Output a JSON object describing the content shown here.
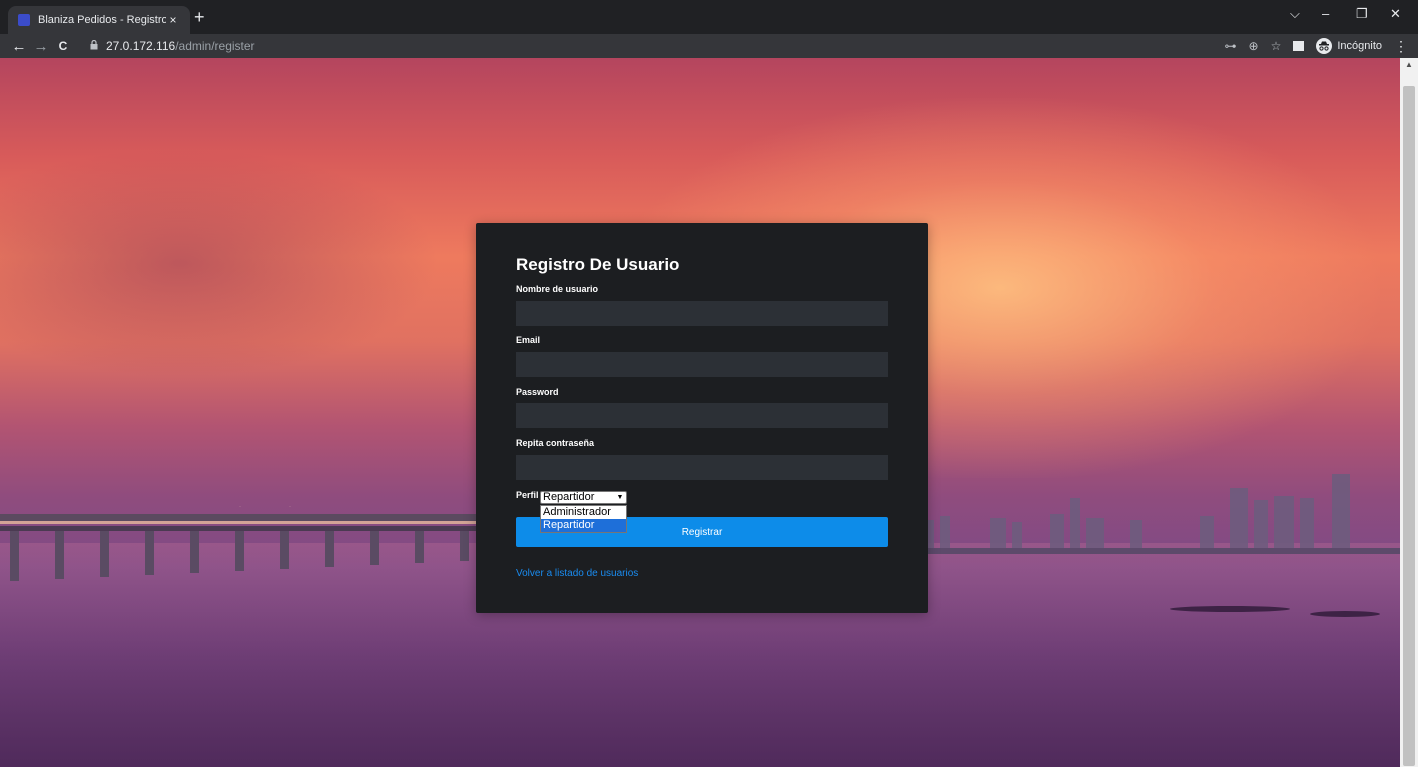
{
  "browser": {
    "tab_title": "Blaniza Pedidos - Registro",
    "tab_close": "×",
    "new_tab": "+",
    "window_controls": {
      "tab_search": "⌵",
      "minimize": "–",
      "restore": "❐",
      "close": "✕"
    },
    "nav": {
      "back": "←",
      "forward": "→",
      "reload": "C"
    },
    "url_host": "27.0.172.116",
    "url_path": "/admin/register",
    "toolbar_icons": {
      "key": "⊶",
      "zoom": "⊕",
      "bookmark": "☆",
      "menu": "⋮"
    },
    "incognito_label": "Incógnito"
  },
  "form": {
    "title": "Registro De Usuario",
    "fields": {
      "username_label": "Nombre de usuario",
      "email_label": "Email",
      "password_label": "Password",
      "confirm_label": "Repita contraseña"
    },
    "profile": {
      "label": "Perfil",
      "selected": "Repartidor",
      "options": [
        "Administrador",
        "Repartidor"
      ]
    },
    "submit_label": "Registrar",
    "back_link": "Volver a listado de usuarios"
  },
  "colors": {
    "accent": "#0d8ce9",
    "link": "#1a8cf0",
    "card_bg": "#1c1e21",
    "input_bg": "#2c3036"
  }
}
